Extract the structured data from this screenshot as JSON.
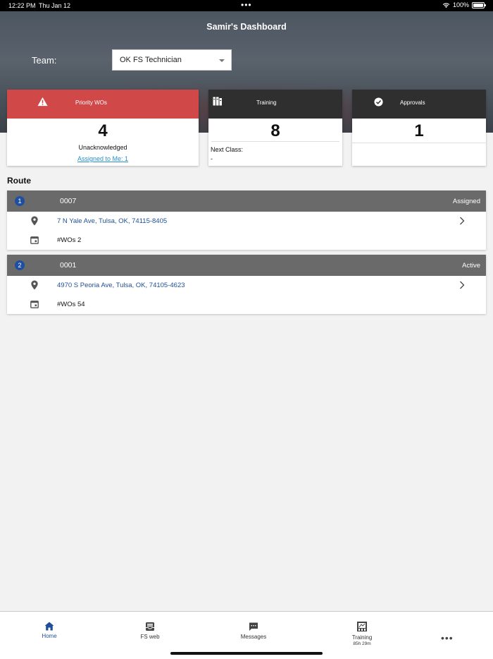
{
  "status_bar": {
    "time": "12:22 PM",
    "date": "Thu Jan 12",
    "battery": "100%",
    "dots": "•••"
  },
  "header": {
    "title": "Samir's Dashboard",
    "team_label": "Team:",
    "team_value": "OK FS Technician"
  },
  "cards": {
    "priority": {
      "label": "Priority WOs",
      "count": "4",
      "sub": "Unacknowledged",
      "link": "Assigned to Me: 1"
    },
    "training": {
      "label": "Training",
      "count": "8",
      "next_label": "Next Class:",
      "next_value": "-"
    },
    "approvals": {
      "label": "Approvals",
      "count": "1"
    }
  },
  "route": {
    "title": "Route",
    "items": [
      {
        "index": "1",
        "code": "0007",
        "status": "Assigned",
        "address": "7 N Yale Ave, Tulsa, OK, 74115-8405",
        "wos": "#WOs  2"
      },
      {
        "index": "2",
        "code": "0001",
        "status": "Active",
        "address": "4970 S Peoria Ave, Tulsa, OK, 74105-4623",
        "wos": "#WOs  54"
      }
    ]
  },
  "nav": {
    "home": "Home",
    "fsweb": "FS web",
    "messages": "Messages",
    "training": "Training",
    "training_sub": "85h 29m",
    "more": "•••"
  },
  "colors": {
    "priority": "#d04848",
    "dark": "#2f2f2f",
    "route_bar": "#6a6a6a",
    "accent": "#1f4f96",
    "link": "#2a8fc6"
  }
}
